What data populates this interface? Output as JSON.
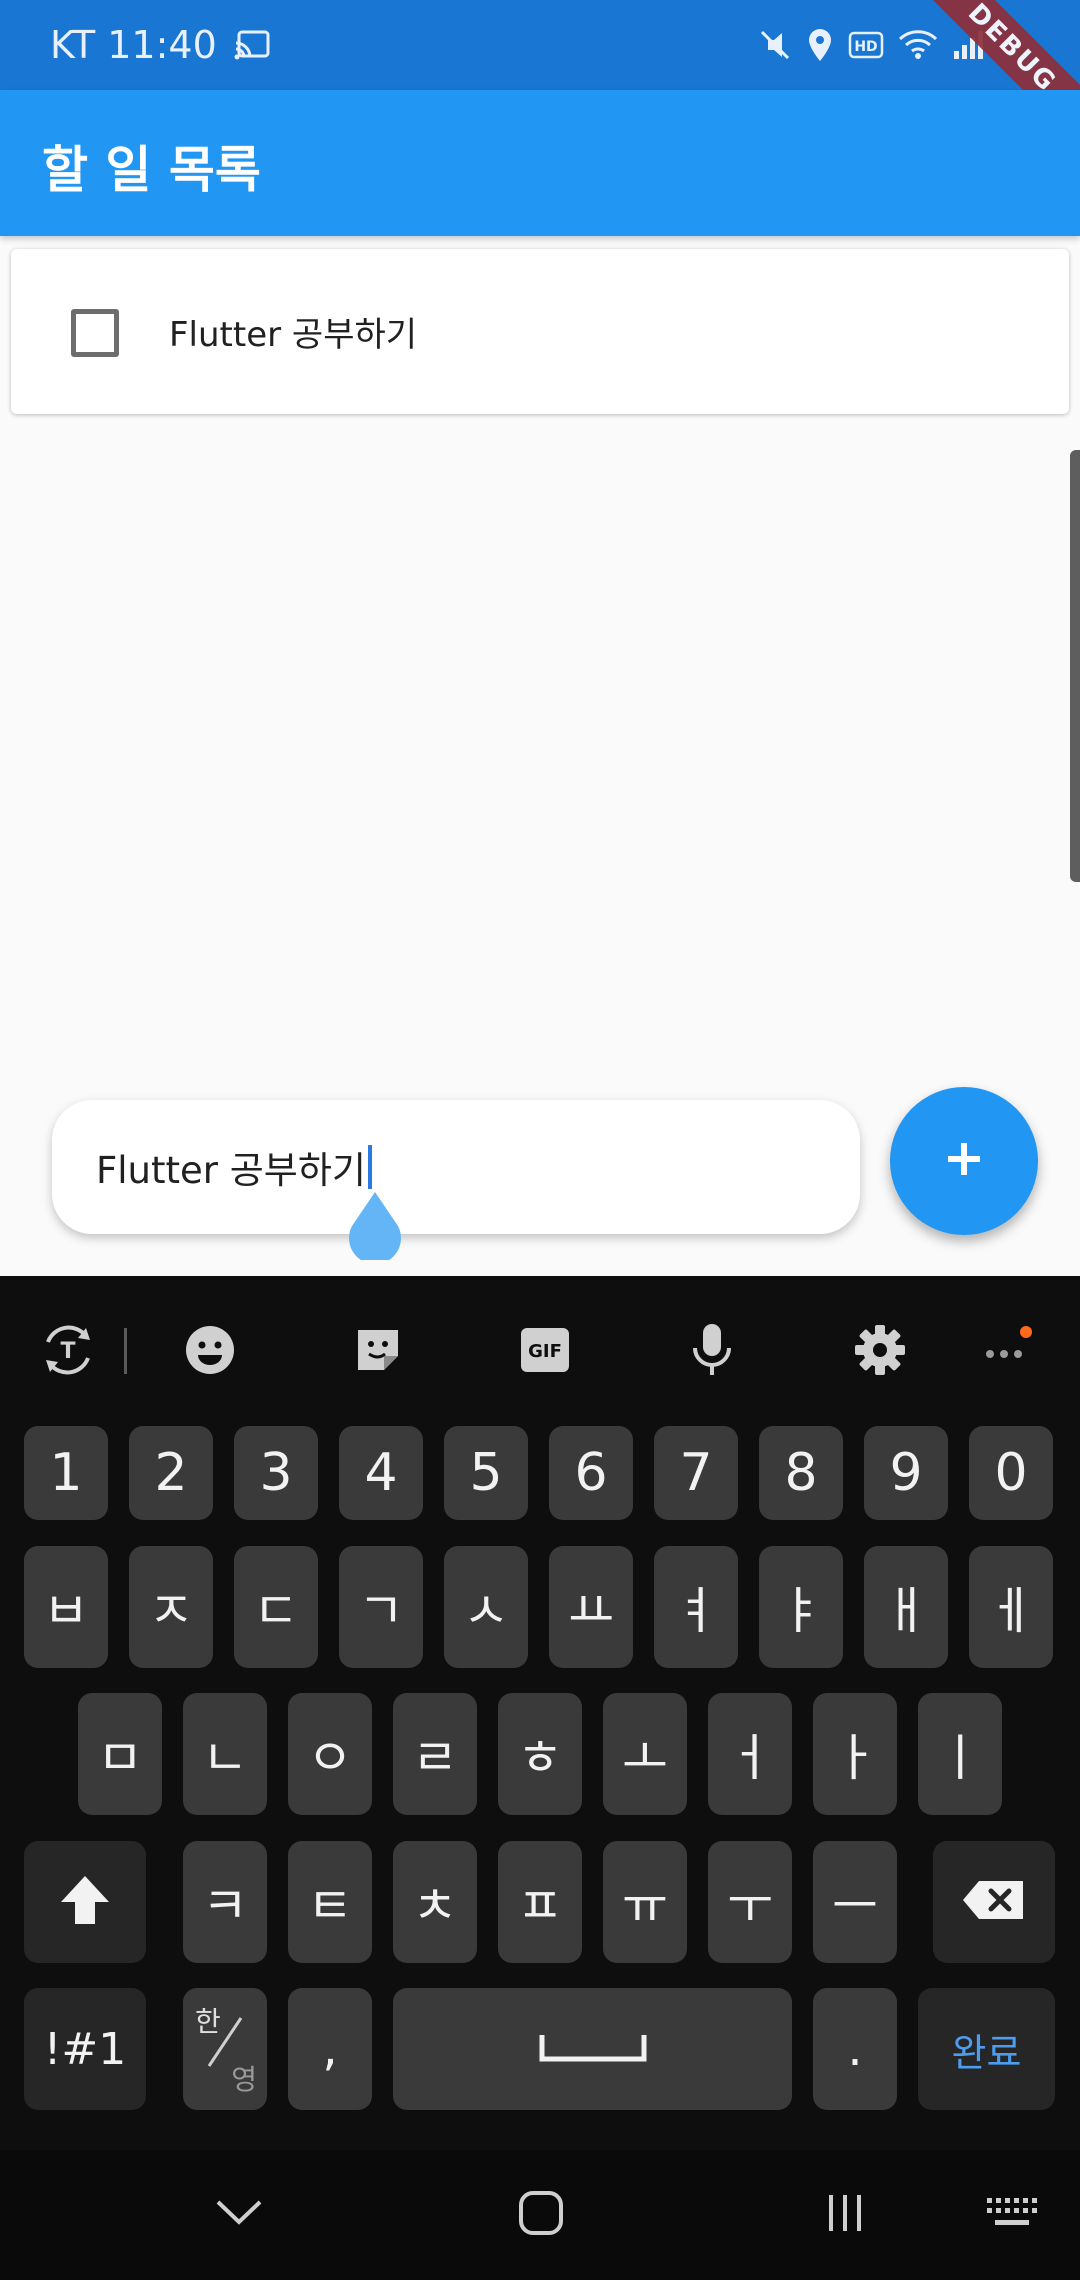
{
  "status_bar": {
    "carrier_time": "KT 11:40",
    "debug_label": "DEBUG"
  },
  "app_bar": {
    "title": "할 일 목록"
  },
  "todos": [
    {
      "text": "Flutter 공부하기",
      "checked": false
    }
  ],
  "input": {
    "value": "Flutter 공부하기"
  },
  "fab": {
    "icon": "plus-icon"
  },
  "keyboard": {
    "toolbar_icons": [
      "translate-icon",
      "emoji-icon",
      "sticker-icon",
      "gif-icon",
      "mic-icon",
      "settings-icon",
      "more-icon"
    ],
    "gif_label": "GIF",
    "row_numbers": [
      "1",
      "2",
      "3",
      "4",
      "5",
      "6",
      "7",
      "8",
      "9",
      "0"
    ],
    "row_1": [
      "ㅂ",
      "ㅈ",
      "ㄷ",
      "ㄱ",
      "ㅅ",
      "ㅛ",
      "ㅕ",
      "ㅑ",
      "ㅐ",
      "ㅔ"
    ],
    "row_2": [
      "ㅁ",
      "ㄴ",
      "ㅇ",
      "ㄹ",
      "ㅎ",
      "ㅗ",
      "ㅓ",
      "ㅏ",
      "ㅣ"
    ],
    "row_3": [
      "ㅋ",
      "ㅌ",
      "ㅊ",
      "ㅍ",
      "ㅠ",
      "ㅜ",
      "ㅡ"
    ],
    "symbols_label": "!#1",
    "lang_top": "한",
    "lang_bottom": "영",
    "comma": ",",
    "period": ".",
    "done_label": "완료"
  },
  "colors": {
    "primary": "#2196f3",
    "status_bar": "#1976d2",
    "keyboard_bg": "#0e0e0e",
    "key_bg": "#3a3a3a",
    "done_text": "#4c9cf0"
  }
}
